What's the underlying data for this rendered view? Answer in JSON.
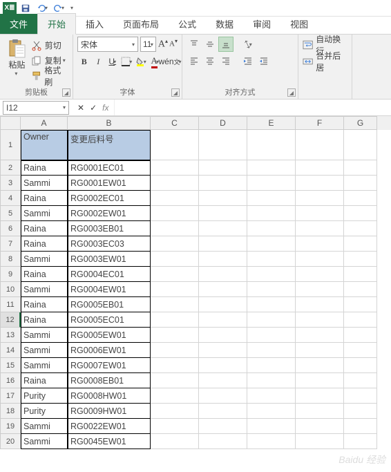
{
  "qat": {
    "save": "保存",
    "undo": "撤销",
    "redo": "重做"
  },
  "tabs": {
    "file": "文件",
    "home": "开始",
    "insert": "插入",
    "layout": "页面布局",
    "formulas": "公式",
    "data": "数据",
    "review": "审阅",
    "view": "视图"
  },
  "ribbon": {
    "clipboard": {
      "label": "剪贴板",
      "paste": "粘贴",
      "cut": "剪切",
      "copy": "复制",
      "format": "格式刷"
    },
    "font": {
      "label": "字体",
      "name": "宋体",
      "size": "11",
      "bold": "B",
      "italic": "I",
      "underline": "U"
    },
    "align": {
      "label": "对齐方式"
    },
    "wrap": {
      "wrap": "自动换行",
      "merge": "合并后居"
    }
  },
  "namebox": {
    "ref": "I12"
  },
  "columns": [
    "A",
    "B",
    "C",
    "D",
    "E",
    "F",
    "G"
  ],
  "headers": {
    "A": "Owner",
    "B": "变更后料号"
  },
  "chart_data": {
    "type": "table",
    "columns": [
      "Owner",
      "变更后料号"
    ],
    "rows": [
      {
        "r": 2,
        "owner": "Raina",
        "code": "RG0001EC01"
      },
      {
        "r": 3,
        "owner": "Sammi",
        "code": "RG0001EW01"
      },
      {
        "r": 4,
        "owner": "Raina",
        "code": "RG0002EC01"
      },
      {
        "r": 5,
        "owner": "Sammi",
        "code": "RG0002EW01"
      },
      {
        "r": 6,
        "owner": "Raina",
        "code": "RG0003EB01"
      },
      {
        "r": 7,
        "owner": "Raina",
        "code": "RG0003EC03"
      },
      {
        "r": 8,
        "owner": "Sammi",
        "code": "RG0003EW01"
      },
      {
        "r": 9,
        "owner": "Raina",
        "code": "RG0004EC01"
      },
      {
        "r": 10,
        "owner": "Sammi",
        "code": "RG0004EW01"
      },
      {
        "r": 11,
        "owner": "Raina",
        "code": "RG0005EB01"
      },
      {
        "r": 12,
        "owner": "Raina",
        "code": "RG0005EC01"
      },
      {
        "r": 13,
        "owner": "Sammi",
        "code": "RG0005EW01"
      },
      {
        "r": 14,
        "owner": "Sammi",
        "code": "RG0006EW01"
      },
      {
        "r": 15,
        "owner": "Sammi",
        "code": "RG0007EW01"
      },
      {
        "r": 16,
        "owner": "Raina",
        "code": "RG0008EB01"
      },
      {
        "r": 17,
        "owner": "Purity",
        "code": "RG0008HW01"
      },
      {
        "r": 18,
        "owner": "Purity",
        "code": "RG0009HW01"
      },
      {
        "r": 19,
        "owner": "Sammi",
        "code": "RG0022EW01"
      },
      {
        "r": 20,
        "owner": "Sammi",
        "code": "RG0045EW01"
      }
    ]
  },
  "active_cell": "I12",
  "selected_row": 12,
  "watermark": "Baidu 经验"
}
